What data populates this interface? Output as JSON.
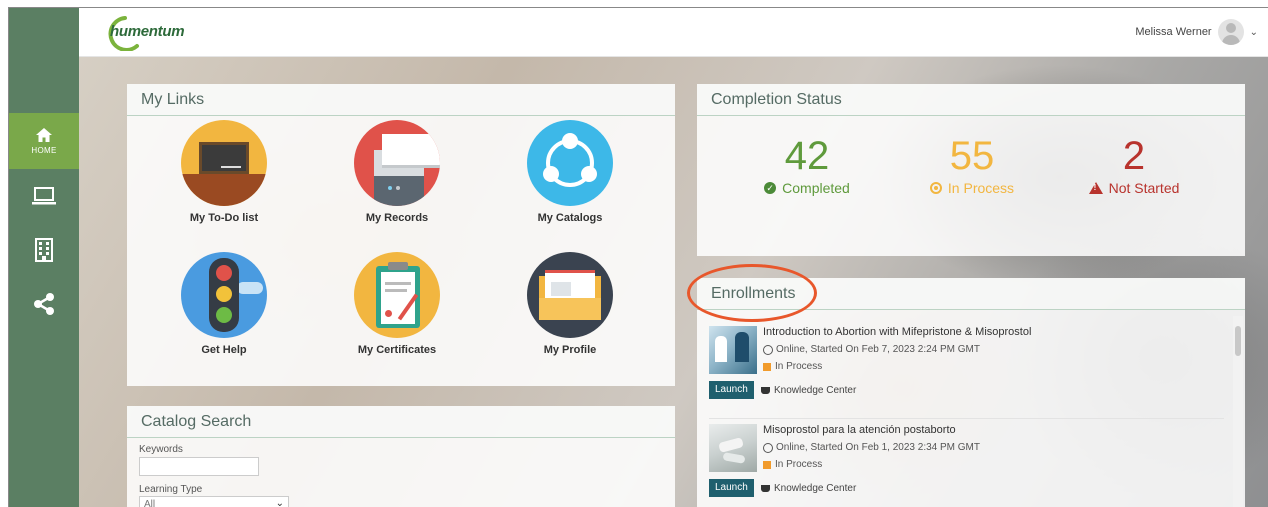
{
  "header": {
    "logo_text": "humentum",
    "user_name": "Melissa Werner"
  },
  "rail": {
    "home_label": "HOME"
  },
  "my_links": {
    "title": "My Links",
    "tiles": [
      {
        "label": "My To-Do list",
        "icon": "chalkboard-icon"
      },
      {
        "label": "My Records",
        "icon": "printer-icon"
      },
      {
        "label": "My Catalogs",
        "icon": "share-network-icon"
      },
      {
        "label": "Get Help",
        "icon": "traffic-light-icon"
      },
      {
        "label": "My Certificates",
        "icon": "certificate-clipboard-icon"
      },
      {
        "label": "My Profile",
        "icon": "envelope-icon"
      }
    ]
  },
  "catalog_search": {
    "title": "Catalog Search",
    "keywords_label": "Keywords",
    "keywords_value": "",
    "learning_type_label": "Learning Type",
    "learning_type_value": "All"
  },
  "completion_status": {
    "title": "Completion Status",
    "completed_count": "42",
    "completed_label": "Completed",
    "in_process_count": "55",
    "in_process_label": "In Process",
    "not_started_count": "2",
    "not_started_label": "Not Started",
    "colors": {
      "completed": "#5f9a3c",
      "in_process": "#f2b640",
      "not_started": "#b8332d"
    }
  },
  "enrollments": {
    "title": "Enrollments",
    "items": [
      {
        "title": "Introduction to Abortion with Mifepristone & Misoprostol",
        "meta": "Online, Started On Feb 7, 2023 2:24 PM GMT",
        "status": "In Process",
        "launch": "Launch",
        "provider": "Knowledge Center"
      },
      {
        "title": "Misoprostol para la atención postaborto",
        "meta": "Online, Started On Feb 1, 2023 2:34 PM GMT",
        "status": "In Process",
        "launch": "Launch",
        "provider": "Knowledge Center"
      }
    ]
  }
}
